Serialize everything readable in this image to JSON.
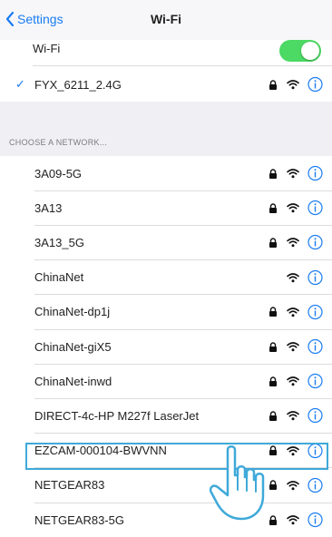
{
  "nav": {
    "back_label": "Settings",
    "title": "Wi-Fi"
  },
  "wifi_toggle": {
    "label": "Wi-Fi",
    "on": true
  },
  "connected": {
    "name": "FYX_6211_2.4G",
    "secured": true
  },
  "section_header": "CHOOSE A NETWORK...",
  "networks": [
    {
      "name": "3A09-5G",
      "secured": true
    },
    {
      "name": "3A13",
      "secured": true
    },
    {
      "name": "3A13_5G",
      "secured": true
    },
    {
      "name": "ChinaNet",
      "secured": false
    },
    {
      "name": "ChinaNet-dp1j",
      "secured": true
    },
    {
      "name": "ChinaNet-giX5",
      "secured": true
    },
    {
      "name": "ChinaNet-inwd",
      "secured": true
    },
    {
      "name": "DIRECT-4c-HP M227f LaserJet",
      "secured": true
    },
    {
      "name": "EZCAM-000104-BWVNN",
      "secured": true,
      "highlighted": true
    },
    {
      "name": "NETGEAR83",
      "secured": true
    },
    {
      "name": "NETGEAR83-5G",
      "secured": true
    }
  ],
  "colors": {
    "accent": "#1a7cf2",
    "toggle_on": "#4cd964",
    "highlight": "#3fa9d9"
  }
}
